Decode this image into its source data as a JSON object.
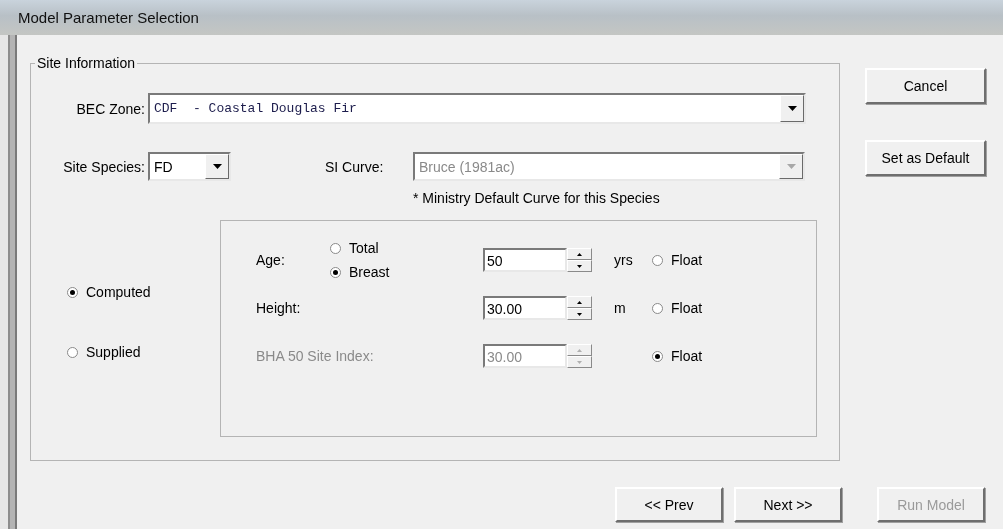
{
  "window": {
    "title": "Model Parameter Selection"
  },
  "site_information": {
    "title": "Site Information",
    "bec_zone": {
      "label": "BEC Zone:",
      "value": "CDF  - Coastal Douglas Fir"
    },
    "site_species": {
      "label": "Site Species:",
      "value": "FD"
    },
    "si_curve": {
      "label": "SI Curve:",
      "value": "Bruce (1981ac)",
      "disabled": true,
      "note": "* Ministry Default Curve for this Species"
    },
    "mode_options": [
      {
        "label": "Computed",
        "selected": true
      },
      {
        "label": "Supplied",
        "selected": false
      }
    ],
    "age_basis": [
      {
        "label": "Total",
        "selected": false
      },
      {
        "label": "Breast",
        "selected": true
      }
    ],
    "parameters": [
      {
        "label": "Age:",
        "value": "50",
        "unit": "yrs",
        "disabled": false,
        "float": {
          "label": "Float",
          "selected": false
        }
      },
      {
        "label": "Height:",
        "value": "30.00",
        "unit": "m",
        "disabled": false,
        "float": {
          "label": "Float",
          "selected": false
        }
      },
      {
        "label": "BHA 50 Site Index:",
        "value": "30.00",
        "disabled": true,
        "float": {
          "label": "Float",
          "selected": true
        }
      }
    ]
  },
  "side_buttons": [
    {
      "label": "Cancel",
      "disabled": false
    },
    {
      "label": "Set as Default",
      "disabled": false
    }
  ],
  "nav_buttons": [
    {
      "label": "<< Prev",
      "disabled": false
    },
    {
      "label": "Next >>",
      "disabled": false
    },
    {
      "label": "Run Model",
      "disabled": true
    }
  ]
}
